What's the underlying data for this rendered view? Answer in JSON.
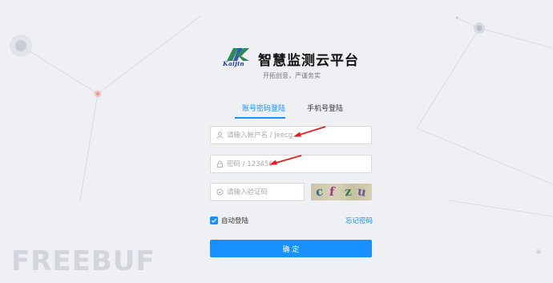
{
  "brand": {
    "logo_text": "Kaijin",
    "title": "智慧监测云平台",
    "slogan": "开拓创意，严谨务实"
  },
  "tabs": [
    {
      "label": "账号密码登陆",
      "active": true
    },
    {
      "label": "手机号登陆",
      "active": false
    }
  ],
  "form": {
    "username_placeholder": "请输入帐户名 / jeecg",
    "password_placeholder": "密码 / 123456",
    "captcha_placeholder": "请输入验证码",
    "captcha_chars": [
      "c",
      "f",
      "z",
      "u"
    ],
    "remember_label": "自动登陆",
    "remember_checked": true,
    "forgot_label": "忘记密码",
    "submit_label": "确 定"
  },
  "watermark": "FREEBUF",
  "colors": {
    "accent": "#1890ff",
    "background": "#eef0f4",
    "annotation_arrow": "#e02020"
  },
  "icons": [
    "user-icon",
    "lock-icon",
    "shield-icon",
    "check-icon"
  ]
}
